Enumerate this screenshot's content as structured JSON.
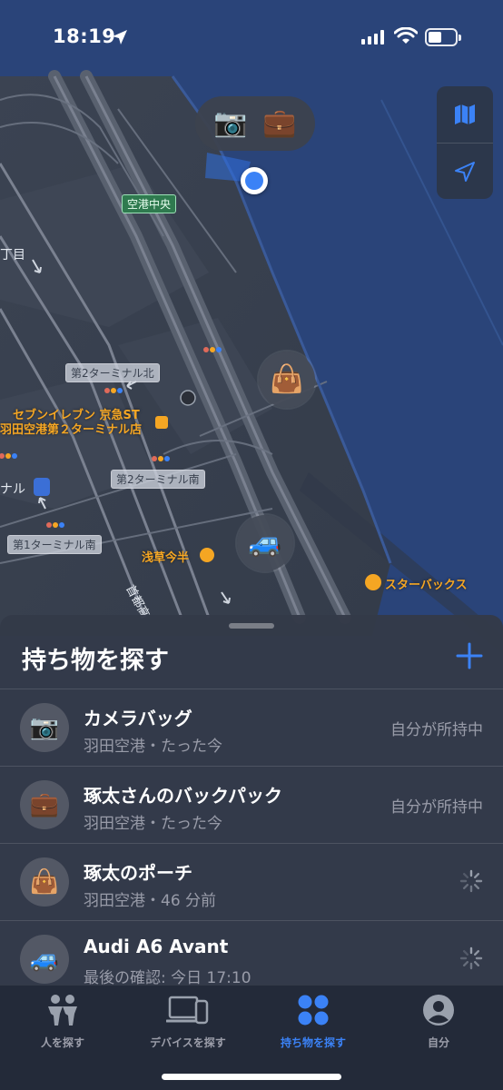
{
  "status_bar": {
    "time": "18:19"
  },
  "map": {
    "labels": {
      "airport_central": "空港中央",
      "chome": "丁目",
      "t2_north": "第2ターミナル北",
      "seven_line1": "セブンイレブン 京急ST",
      "seven_line2": "羽田空港第２ターミナル店",
      "t2_south": "第2ターミナル南",
      "nal": "ナル",
      "t1_south": "第1ターミナル南",
      "asakusa": "浅草今半",
      "starbucks": "スターバックス",
      "highway": "首都高"
    },
    "pins": {
      "camera": "📷",
      "briefcase": "💼",
      "handbag": "👜",
      "car": "🚙"
    }
  },
  "sheet": {
    "title": "持ち物を探す",
    "items": [
      {
        "icon": "📷",
        "name": "カメラバッグ",
        "subtitle": "羽田空港・たった今",
        "status": "自分が所持中"
      },
      {
        "icon": "💼",
        "name": "琢太さんのバックパック",
        "subtitle": "羽田空港・たった今",
        "status": "自分が所持中"
      },
      {
        "icon": "👜",
        "name": "琢太のポーチ",
        "subtitle": "羽田空港・46 分前",
        "status": ""
      },
      {
        "icon": "🚙",
        "name": "Audi A6 Avant",
        "subtitle": "最後の確認: 今日 17:10",
        "status": ""
      }
    ]
  },
  "tabs": [
    {
      "label": "人を探す",
      "icon": "people-icon"
    },
    {
      "label": "デバイスを探す",
      "icon": "devices-icon"
    },
    {
      "label": "持ち物を探す",
      "icon": "items-icon",
      "active": true
    },
    {
      "label": "自分",
      "icon": "person-icon"
    }
  ],
  "colors": {
    "accent": "#3b82f6",
    "map_water": "#2a4479",
    "poi": "#f5a623"
  }
}
